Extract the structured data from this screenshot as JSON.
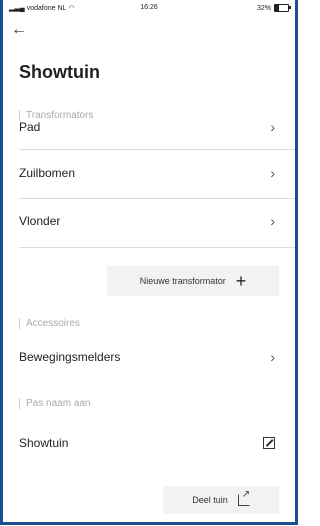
{
  "statusbar": {
    "carrier": "vodafone NL",
    "time": "16:26",
    "battery": "32%",
    "battery_level": 0.32
  },
  "header": {
    "back_icon": "arrow-left-icon",
    "title": "Showtuin"
  },
  "sections": {
    "transformators": {
      "label": "Transformators",
      "items": [
        "Pad",
        "Zuilbomen",
        "Vlonder"
      ]
    },
    "accessoires": {
      "label": "Accessoires",
      "items": [
        "Bewegingsmelders"
      ]
    },
    "rename": {
      "label": "Pas naam aan",
      "value": "Showtuin"
    }
  },
  "buttons": {
    "new_transformator": "Nieuwe transformator",
    "share_garden": "Deel tuin"
  },
  "colors": {
    "frame": "#1b4f8f",
    "button_bg": "#f2f2f2"
  }
}
